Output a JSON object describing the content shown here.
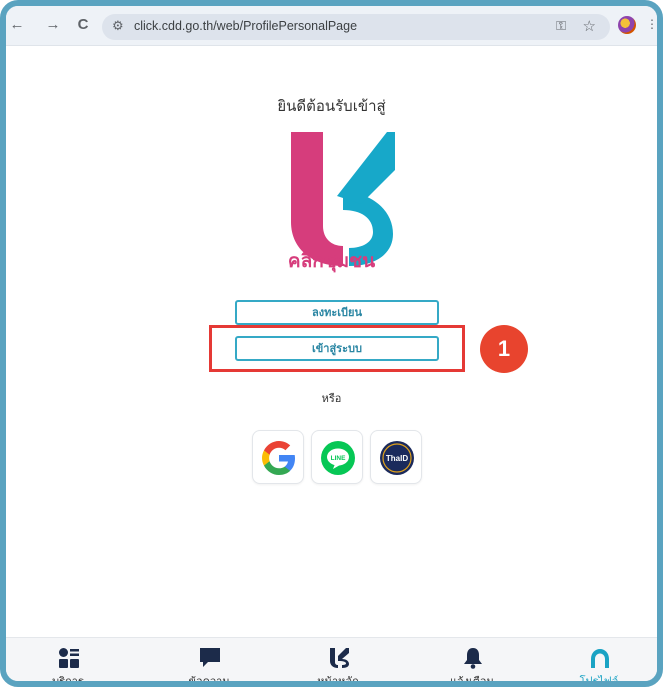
{
  "browser": {
    "url": "click.cdd.go.th/web/ProfilePersonalPage",
    "back_icon": "←",
    "forward_icon": "→",
    "reload_icon": "C"
  },
  "content": {
    "welcome": "ยินดีต้อนรับเข้าสู่",
    "brand_name": "คลิกชุมชน",
    "register_button": "ลงทะเบียน",
    "login_button": "เข้าสู่ระบบ",
    "or_text": "หรือ",
    "step_number": "1",
    "social": {
      "thaid_label": "ThaID"
    }
  },
  "bottom_nav": {
    "services": "บริการ",
    "messages": "ข้อความ",
    "home": "หน้าหลัก",
    "notifications": "แจ้งเตือน",
    "profile": "โปรไฟล์"
  },
  "colors": {
    "brand_pink": "#d63d7c",
    "brand_blue": "#17a8c9",
    "highlight_red": "#e53935",
    "frame": "#5aa3c0"
  }
}
